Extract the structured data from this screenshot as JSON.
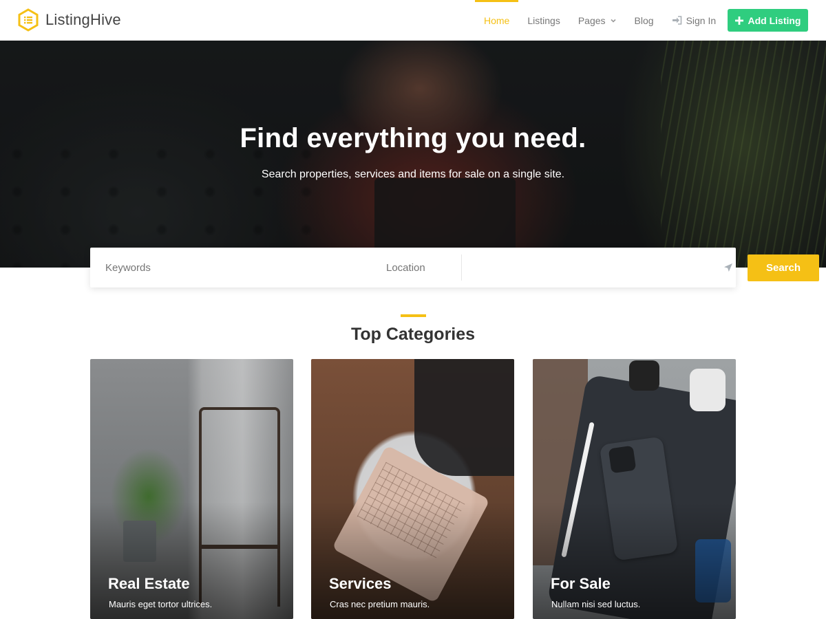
{
  "brand": {
    "name": "ListingHive",
    "accent": "#f5c015",
    "success": "#2fcd7f"
  },
  "nav": {
    "items": [
      {
        "label": "Home",
        "active": true
      },
      {
        "label": "Listings"
      },
      {
        "label": "Pages"
      },
      {
        "label": "Blog"
      },
      {
        "label": "Sign In",
        "icon": "sign-in-icon"
      }
    ],
    "add_listing_label": "Add Listing"
  },
  "hero": {
    "title": "Find everything you need.",
    "subtitle": "Search properties, services and items for sale on a single site."
  },
  "search": {
    "keywords_placeholder": "Keywords",
    "location_placeholder": "Location",
    "location_icon": "location-arrow-icon",
    "button_label": "Search"
  },
  "categories": {
    "title": "Top Categories",
    "items": [
      {
        "title": "Real Estate",
        "description": "Mauris eget tortor ultrices."
      },
      {
        "title": "Services",
        "description": "Cras nec pretium mauris."
      },
      {
        "title": "For Sale",
        "description": "Nullam nisi sed luctus."
      }
    ]
  }
}
